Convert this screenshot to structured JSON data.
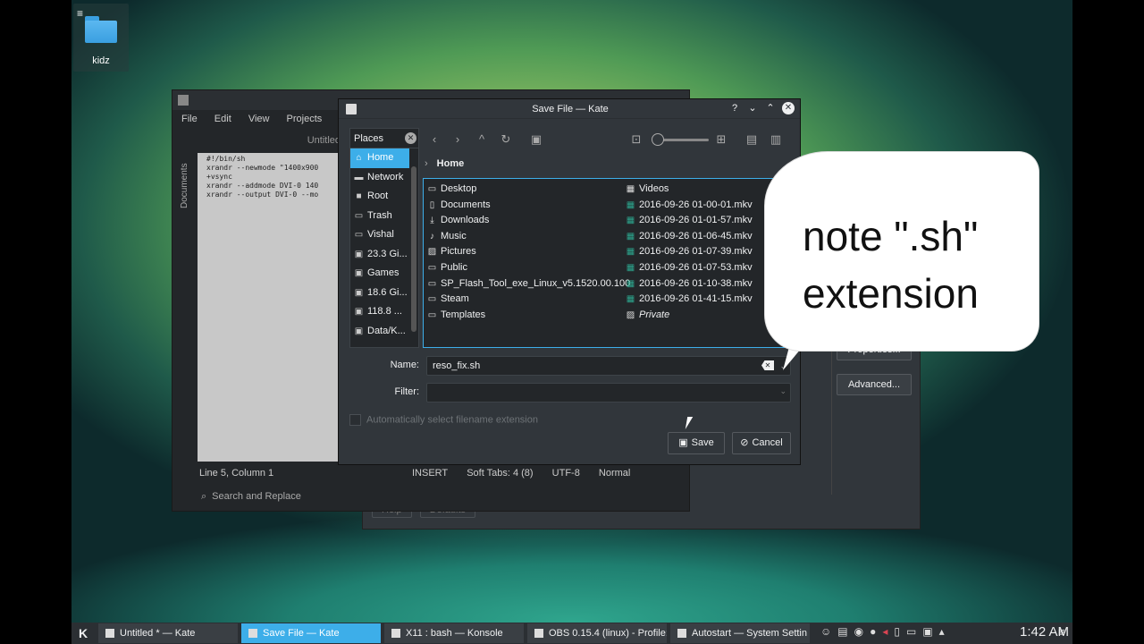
{
  "desktop": {
    "icon_label": "kidz",
    "menu_glyph": "≡"
  },
  "back_window": {
    "properties_label": "Properties...",
    "advanced_label": "Advanced...",
    "help_label": "Help",
    "defaults_label": "Defaults"
  },
  "kate": {
    "menu": [
      "File",
      "Edit",
      "View",
      "Projects",
      "Bo"
    ],
    "side_label": "Documents",
    "tab_label": "Untitled",
    "editor_text": "#!/bin/sh\nxrandr --newmode \"1400x900\n+vsync\nxrandr --addmode DVI-0 140\nxrandr --output DVI-0 --mo\n",
    "status_position": "Line 5, Column 1",
    "status_mode": "INSERT",
    "status_tabs": "Soft Tabs: 4 (8)",
    "status_encoding": "UTF-8",
    "status_syntax": "Normal",
    "search_label": "Search and Replace"
  },
  "dialog": {
    "title": "Save File — Kate",
    "help_glyph": "?",
    "places_title": "Places",
    "places": [
      {
        "icon": "home-icon",
        "glyph": "⌂",
        "label": "Home"
      },
      {
        "icon": "network-icon",
        "glyph": "▬",
        "label": "Network"
      },
      {
        "icon": "root-icon",
        "glyph": "■",
        "label": "Root"
      },
      {
        "icon": "trash-icon",
        "glyph": "▭",
        "label": "Trash"
      },
      {
        "icon": "folder-icon",
        "glyph": "▭",
        "label": "Vishal"
      },
      {
        "icon": "drive-icon",
        "glyph": "▣",
        "label": "23.3 Gi..."
      },
      {
        "icon": "drive-icon",
        "glyph": "▣",
        "label": "Games"
      },
      {
        "icon": "drive-icon",
        "glyph": "▣",
        "label": "18.6 Gi..."
      },
      {
        "icon": "drive-icon",
        "glyph": "▣",
        "label": "118.8 ..."
      },
      {
        "icon": "drive-icon",
        "glyph": "▣",
        "label": "Data/K..."
      }
    ],
    "breadcrumb": "Home",
    "files_left": [
      {
        "icon": "folder-icon",
        "glyph": "▭",
        "label": "Desktop"
      },
      {
        "icon": "documents-icon",
        "glyph": "▯",
        "label": "Documents"
      },
      {
        "icon": "download-icon",
        "glyph": "⤓",
        "label": "Downloads"
      },
      {
        "icon": "music-icon",
        "glyph": "♪",
        "label": "Music"
      },
      {
        "icon": "pictures-icon",
        "glyph": "▨",
        "label": "Pictures"
      },
      {
        "icon": "folder-icon",
        "glyph": "▭",
        "label": "Public"
      },
      {
        "icon": "folder-icon",
        "glyph": "▭",
        "label": "SP_Flash_Tool_exe_Linux_v5.1520.00.100"
      },
      {
        "icon": "folder-icon",
        "glyph": "▭",
        "label": "Steam"
      },
      {
        "icon": "folder-icon",
        "glyph": "▭",
        "label": "Templates"
      }
    ],
    "files_right": [
      {
        "icon": "videos-icon",
        "glyph": "▦",
        "label": "Videos",
        "video": false,
        "italic": false
      },
      {
        "icon": "video-file-icon",
        "glyph": "▦",
        "label": "2016-09-26 01-00-01.mkv",
        "video": true,
        "italic": false
      },
      {
        "icon": "video-file-icon",
        "glyph": "▦",
        "label": "2016-09-26 01-01-57.mkv",
        "video": true,
        "italic": false
      },
      {
        "icon": "video-file-icon",
        "glyph": "▦",
        "label": "2016-09-26 01-06-45.mkv",
        "video": true,
        "italic": false
      },
      {
        "icon": "video-file-icon",
        "glyph": "▦",
        "label": "2016-09-26 01-07-39.mkv",
        "video": true,
        "italic": false
      },
      {
        "icon": "video-file-icon",
        "glyph": "▦",
        "label": "2016-09-26 01-07-53.mkv",
        "video": true,
        "italic": false
      },
      {
        "icon": "video-file-icon",
        "glyph": "▦",
        "label": "2016-09-26 01-10-38.mkv",
        "video": true,
        "italic": false
      },
      {
        "icon": "video-file-icon",
        "glyph": "▦",
        "label": "2016-09-26 01-41-15.mkv",
        "video": true,
        "italic": false
      },
      {
        "icon": "private-folder-icon",
        "glyph": "▨",
        "label": "Private",
        "video": false,
        "italic": true
      }
    ],
    "name_label": "Name:",
    "name_value": "reso_fix.sh",
    "filter_label": "Filter:",
    "filter_value": "",
    "auto_ext_label": "Automatically select filename extension",
    "save_label": "Save",
    "cancel_label": "Cancel"
  },
  "callout": {
    "line1": "note \".sh\"",
    "line2": "extension"
  },
  "taskbar": {
    "tasks": [
      {
        "label": "Untitled * — Kate",
        "active": false
      },
      {
        "label": "Save File — Kate",
        "active": true
      },
      {
        "label": "X11 : bash — Konsole",
        "active": false
      },
      {
        "label": "OBS 0.15.4 (linux) - Profile:",
        "active": false
      },
      {
        "label": "Autostart — System Settin",
        "active": false
      }
    ],
    "clock": "1:42 AM",
    "accent": "#3daee9"
  }
}
